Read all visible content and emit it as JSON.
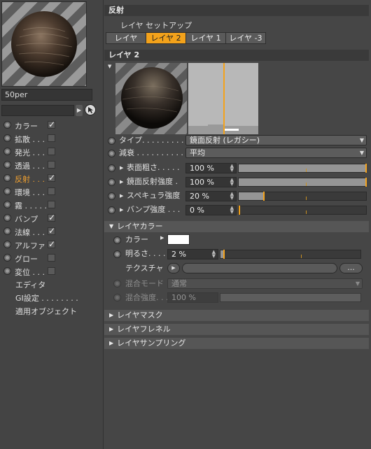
{
  "material": {
    "name": "50per"
  },
  "channels": [
    {
      "label": "カラー",
      "checked": true,
      "active": false
    },
    {
      "label": "拡散 . . .",
      "checked": false,
      "active": false
    },
    {
      "label": "発光 . . .",
      "checked": false,
      "active": false
    },
    {
      "label": "透過 . . .",
      "checked": false,
      "active": false
    },
    {
      "label": "反射 . . .",
      "checked": true,
      "active": true
    },
    {
      "label": "環境 . . .",
      "checked": false,
      "active": false
    },
    {
      "label": "霧 . . . . .",
      "checked": false,
      "active": false
    },
    {
      "label": "バンプ",
      "checked": true,
      "active": false
    },
    {
      "label": "法線 . . .",
      "checked": true,
      "active": false
    },
    {
      "label": "アルファ",
      "checked": true,
      "active": false
    },
    {
      "label": "グロー",
      "checked": false,
      "active": false
    },
    {
      "label": "変位 . . .",
      "checked": false,
      "active": false
    }
  ],
  "extras": [
    "エディタ",
    "GI設定 . . . . . . . .",
    "適用オブジェクト"
  ],
  "reflection": {
    "title": "反射",
    "layer_setup": "レイヤ セットアップ",
    "tabs": [
      "レイヤ",
      "レイヤ 2",
      "レイヤ 1",
      "レイヤ -3"
    ],
    "selected_tab": 1,
    "layer_header": "レイヤ 2",
    "type_label": "タイプ. . . . . . . . .",
    "type_value": "鏡面反射 (レガシー)",
    "atten_label": "減衰 . . . . . . . . . . .",
    "atten_value": "平均",
    "params": [
      {
        "label": "表面粗さ. . . . .",
        "value": "100 %",
        "level": 1.0
      },
      {
        "label": "鏡面反射強度 .",
        "value": "100 %",
        "level": 1.0
      },
      {
        "label": "スペキュラ強度",
        "value": "20 %",
        "level": 0.2
      },
      {
        "label": "バンプ強度 . . .",
        "value": "0 %",
        "level": 0.0
      }
    ]
  },
  "layer_color": {
    "title": "レイヤカラー",
    "color_label": "カラー",
    "color_value": "#ffffff",
    "brightness_label": "明るさ. . . .",
    "brightness_value": "2 %",
    "brightness_level": 0.02,
    "texture_label": "テクスチャ",
    "texture_button": "...",
    "blend_mode_label": "混合モード",
    "blend_mode_value": "通常",
    "blend_strength_label": "混合強度. . .",
    "blend_strength_value": "100 %"
  },
  "sections": [
    "レイヤマスク",
    "レイヤフレネル",
    "レイヤサンプリング"
  ],
  "colors": {
    "accent": "#f3a21b",
    "panel": "#464646",
    "header": "#3a3a3a"
  }
}
